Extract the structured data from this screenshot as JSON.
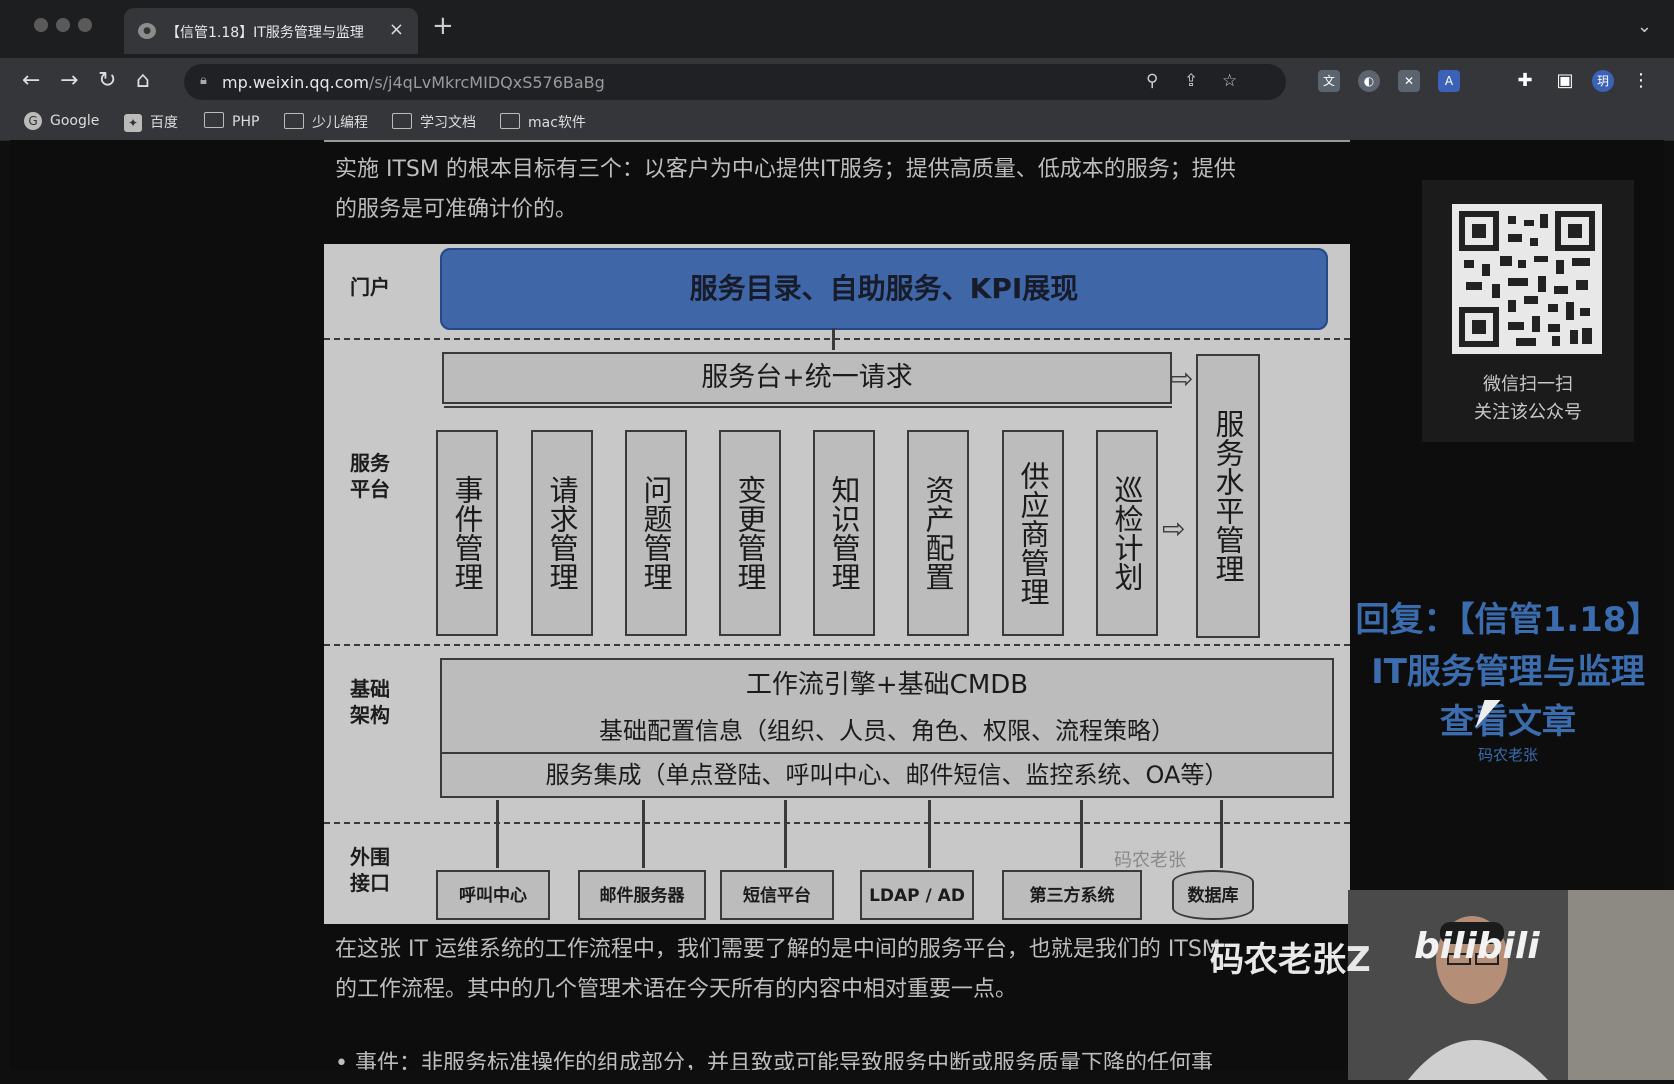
{
  "browser": {
    "tab_title": "【信管1.18】IT服务管理与监理",
    "tab_close": "×",
    "new_tab": "+",
    "tab_menu": "⌄",
    "url_host": "mp.weixin.qq.com",
    "url_path": "/s/j4qLvMkrcMIDQxS576BaBg",
    "nav": {
      "back": "←",
      "forward": "→",
      "reload": "↻",
      "home": "⌂"
    },
    "profile_initial": "玥"
  },
  "bookmarks": [
    {
      "label": "Google"
    },
    {
      "label": "百度"
    },
    {
      "label": "PHP"
    },
    {
      "label": "少儿编程"
    },
    {
      "label": "学习文档"
    },
    {
      "label": "mac软件"
    }
  ],
  "article": {
    "para1_line1": "实施 ITSM 的根本目标有三个：以客户为中心提供IT服务；提供高质量、低成本的服务；提供",
    "para1_line2": "的服务是可准确计价的。",
    "para2_line1": "在这张 IT 运维系统的工作流程中，我们需要了解的是中间的服务平台，也就是我们的 ITSM",
    "para2_line2": "的工作流程。其中的几个管理术语在今天所有的内容中相对重要一点。",
    "para3_partial": "• 事件：非服务标准操作的组成部分，并且致或可能导致服务中断或服务质量下降的任何事"
  },
  "diagram": {
    "labels": {
      "portal": "门户",
      "service_platform": "服务\n平台",
      "infra": "基础\n架构",
      "external": "外围\n接口"
    },
    "portal_box": "服务目录、自助服务、KPI展现",
    "servicedesk": "服务台+统一请求",
    "processes": [
      "事件管理",
      "请求管理",
      "问题管理",
      "变更管理",
      "知识管理",
      "资产配置",
      "供应商管理",
      "巡检计划"
    ],
    "sla": "服务水平管理",
    "infra_rows": [
      "工作流引擎+基础CMDB",
      "基础配置信息（组织、人员、角色、权限、流程策略）",
      "服务集成（单点登陆、呼叫中心、邮件短信、监控系统、OA等）"
    ],
    "interfaces": [
      "呼叫中心",
      "邮件服务器",
      "短信平台",
      "LDAP / AD",
      "第三方系统",
      "数据库"
    ],
    "inline_watermark": "码农老张"
  },
  "sidebar": {
    "qr_caption1": "微信扫一扫",
    "qr_caption2": "关注该公众号"
  },
  "promo": {
    "line1": "回复：【信管1.18】",
    "line2": "IT服务管理与监理",
    "line3": "查看文章",
    "line4": "码农老张"
  },
  "overlay": {
    "watermark_name": "码农老张Z",
    "watermark_logo": "bilibili"
  },
  "colors": {
    "portal_blue": "#3f66a6",
    "promo_blue": "#3b6cad",
    "figure_gray": "#c8c8c8"
  }
}
